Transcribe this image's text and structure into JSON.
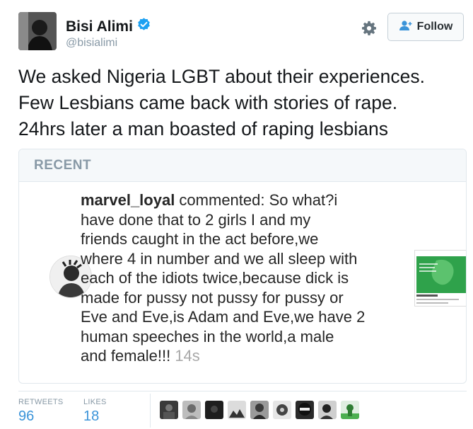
{
  "tweet": {
    "author_name": "Bisi Alimi",
    "author_handle": "@bisialimi",
    "text_lines": [
      "We asked Nigeria LGBT about their experiences.",
      "Few Lesbians came back with stories of rape.",
      "24hrs later a man boasted of raping lesbians"
    ]
  },
  "header": {
    "follow_label": "Follow",
    "icons": [
      "verified-badge-icon",
      "gear-icon",
      "add-user-icon"
    ]
  },
  "card": {
    "section_label": "RECENT",
    "comment": {
      "username": "marvel_loyal",
      "first_line_rest": " commented: So what?i",
      "lines": [
        "have done that to 2 girls I and my",
        "friends caught in the act before,we",
        "where 4 in number and we all sleep with",
        "each of the idiots twice,because dick is",
        "made for pussy not pussy for pussy or",
        "Eve and Eve,is Adam and Eve,we have 2",
        "human speeches in the world,a male"
      ],
      "last_line": "and female!!! ",
      "time": "14s"
    }
  },
  "stats": {
    "retweets_label": "RETWEETS",
    "retweets_value": "96",
    "likes_label": "LIKES",
    "likes_value": "18"
  },
  "colors": {
    "link_blue": "#3b94d9",
    "verified_blue": "#1da1f2",
    "muted_gray": "#8899a6",
    "thumbnail_green": "#2fa24b"
  }
}
